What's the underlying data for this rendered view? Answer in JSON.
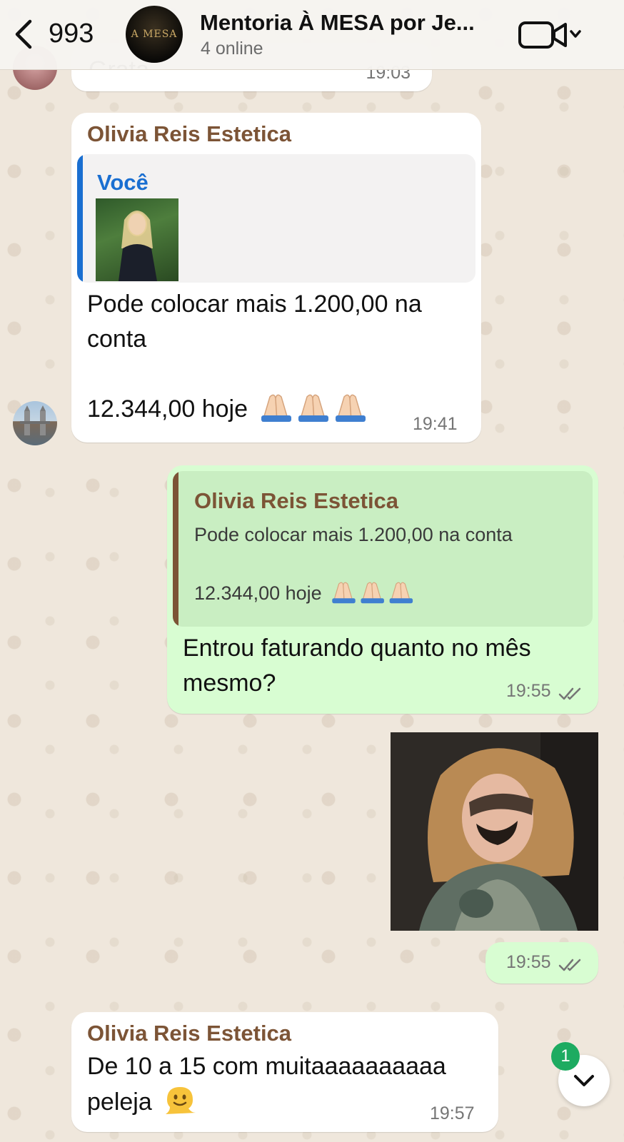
{
  "header": {
    "back_count": "993",
    "group_avatar_text": "A MESA",
    "title": "Mentoria À MESA por Je...",
    "subtitle": "4 online"
  },
  "messages": {
    "m0": {
      "partial_text": "Grata",
      "time": "19:03"
    },
    "m1": {
      "sender": "Olivia Reis Estetica",
      "quote_author": "Você",
      "line1": "Pode colocar mais 1.200,00 na",
      "line2": "conta",
      "line3": "12.344,00 hoje",
      "time": "19:41"
    },
    "m2": {
      "quote_sender": "Olivia Reis Estetica",
      "quote_line1": "Pode colocar mais 1.200,00 na conta",
      "quote_line2": "12.344,00 hoje",
      "line1": "Entrou faturando quanto no mês",
      "line2": "mesmo?",
      "time": "19:55"
    },
    "m3": {
      "time": "19:55"
    },
    "m4": {
      "sender": "Olivia Reis Estetica",
      "line1": "De 10 a 15 com muitaaaaaaaaaa",
      "line2": "peleja",
      "time": "19:57"
    }
  },
  "scroll_button": {
    "unread_badge": "1"
  },
  "colors": {
    "sender": "#7c5436",
    "outgoing_bubble": "#d8fdd2",
    "quote_you": "#1a6fd1",
    "badge": "#1dab61"
  },
  "icons": [
    "back-chevron-icon",
    "video-call-icon",
    "chevron-down-icon",
    "double-check-icon",
    "folded-hands-emoji",
    "melting-face-emoji"
  ]
}
